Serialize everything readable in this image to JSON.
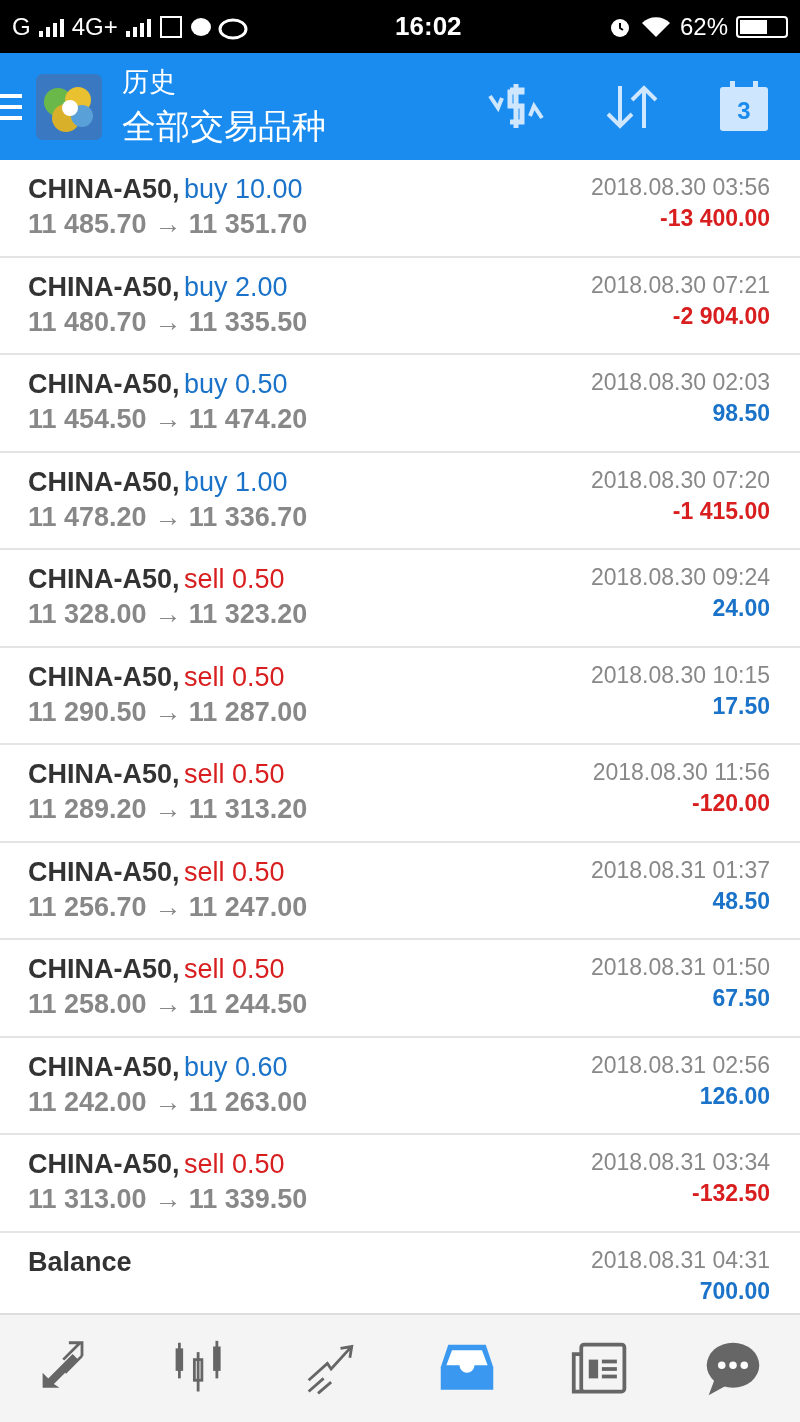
{
  "status_bar": {
    "carrier1": "G",
    "carrier2": "4G+",
    "time": "16:02",
    "battery": "62%"
  },
  "header": {
    "title": "历史",
    "subtitle": "全部交易品种",
    "calendar_day": "3"
  },
  "rows": [
    {
      "kind": "trade",
      "symbol": "CHINA-A50,",
      "side": "buy",
      "volume": "10.00",
      "prices": "11 485.70 → 11 351.70",
      "time": "2018.08.30 03:56",
      "profit": "-13 400.00",
      "color": "#d81e1e"
    },
    {
      "kind": "trade",
      "symbol": "CHINA-A50,",
      "side": "buy",
      "volume": "2.00",
      "prices": "11 480.70 → 11 335.50",
      "time": "2018.08.30 07:21",
      "profit": "-2 904.00",
      "color": "#d81e1e"
    },
    {
      "kind": "trade",
      "symbol": "CHINA-A50,",
      "side": "buy",
      "volume": "0.50",
      "prices": "11 454.50 → 11 474.20",
      "time": "2018.08.30 02:03",
      "profit": "98.50",
      "color": "#1a73c8"
    },
    {
      "kind": "trade",
      "symbol": "CHINA-A50,",
      "side": "buy",
      "volume": "1.00",
      "prices": "11 478.20 → 11 336.70",
      "time": "2018.08.30 07:20",
      "profit": "-1 415.00",
      "color": "#d81e1e"
    },
    {
      "kind": "trade",
      "symbol": "CHINA-A50,",
      "side": "sell",
      "volume": "0.50",
      "prices": "11 328.00 → 11 323.20",
      "time": "2018.08.30 09:24",
      "profit": "24.00",
      "color": "#1a73c8"
    },
    {
      "kind": "trade",
      "symbol": "CHINA-A50,",
      "side": "sell",
      "volume": "0.50",
      "prices": "11 290.50 → 11 287.00",
      "time": "2018.08.30 10:15",
      "profit": "17.50",
      "color": "#1a73c8"
    },
    {
      "kind": "trade",
      "symbol": "CHINA-A50,",
      "side": "sell",
      "volume": "0.50",
      "prices": "11 289.20 → 11 313.20",
      "time": "2018.08.30 11:56",
      "profit": "-120.00",
      "color": "#d81e1e"
    },
    {
      "kind": "trade",
      "symbol": "CHINA-A50,",
      "side": "sell",
      "volume": "0.50",
      "prices": "11 256.70 → 11 247.00",
      "time": "2018.08.31 01:37",
      "profit": "48.50",
      "color": "#1a73c8"
    },
    {
      "kind": "trade",
      "symbol": "CHINA-A50,",
      "side": "sell",
      "volume": "0.50",
      "prices": "11 258.00 → 11 244.50",
      "time": "2018.08.31 01:50",
      "profit": "67.50",
      "color": "#1a73c8"
    },
    {
      "kind": "trade",
      "symbol": "CHINA-A50,",
      "side": "buy",
      "volume": "0.60",
      "prices": "11 242.00 → 11 263.00",
      "time": "2018.08.31 02:56",
      "profit": "126.00",
      "color": "#1a73c8"
    },
    {
      "kind": "trade",
      "symbol": "CHINA-A50,",
      "side": "sell",
      "volume": "0.50",
      "prices": "11 313.00 → 11 339.50",
      "time": "2018.08.31 03:34",
      "profit": "-132.50",
      "color": "#d81e1e"
    },
    {
      "kind": "balance",
      "symbol": "Balance",
      "time": "2018.08.31 04:31",
      "profit": "700.00",
      "color": "#1a73c8"
    }
  ],
  "nav": [
    {
      "kind": "trade",
      "selected": false
    },
    {
      "kind": "quotes",
      "selected": false
    },
    {
      "kind": "chart",
      "selected": false
    },
    {
      "kind": "history",
      "selected": true
    },
    {
      "kind": "news",
      "selected": false
    },
    {
      "kind": "chat",
      "selected": false
    }
  ]
}
